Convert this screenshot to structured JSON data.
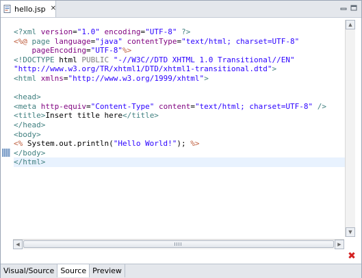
{
  "tab": {
    "label": "hello.jsp",
    "icon": "jsp-file-icon",
    "close_glyph": "✕"
  },
  "window_buttons": [
    "minimize-icon",
    "maximize-icon"
  ],
  "code_lines": [
    [
      {
        "c": "t-tag",
        "t": "<?xml "
      },
      {
        "c": "t-attr",
        "t": "version"
      },
      {
        "c": "t-plain",
        "t": "="
      },
      {
        "c": "t-str",
        "t": "\"1.0\""
      },
      {
        "c": "t-plain",
        "t": " "
      },
      {
        "c": "t-attr",
        "t": "encoding"
      },
      {
        "c": "t-plain",
        "t": "="
      },
      {
        "c": "t-str",
        "t": "\"UTF-8\""
      },
      {
        "c": "t-tag",
        "t": " ?>"
      }
    ],
    [
      {
        "c": "t-jsp",
        "t": "<%@ "
      },
      {
        "c": "t-tag",
        "t": "page "
      },
      {
        "c": "t-attr",
        "t": "language"
      },
      {
        "c": "t-plain",
        "t": "="
      },
      {
        "c": "t-str",
        "t": "\"java\""
      },
      {
        "c": "t-plain",
        "t": " "
      },
      {
        "c": "t-attr",
        "t": "contentType"
      },
      {
        "c": "t-plain",
        "t": "="
      },
      {
        "c": "t-str",
        "t": "\"text/html; charset=UTF-8\""
      }
    ],
    [
      {
        "c": "t-plain",
        "t": "    "
      },
      {
        "c": "t-attr",
        "t": "pageEncoding"
      },
      {
        "c": "t-plain",
        "t": "="
      },
      {
        "c": "t-str",
        "t": "\"UTF-8\""
      },
      {
        "c": "t-jsp",
        "t": "%>"
      }
    ],
    [
      {
        "c": "t-tag",
        "t": "<!DOCTYPE "
      },
      {
        "c": "t-plain",
        "t": "html "
      },
      {
        "c": "t-doc",
        "t": "PUBLIC "
      },
      {
        "c": "t-str",
        "t": "\"-//W3C//DTD XHTML 1.0 Transitional//EN\""
      }
    ],
    [
      {
        "c": "t-str",
        "t": "\"http://www.w3.org/TR/xhtml1/DTD/xhtml1-transitional.dtd\""
      },
      {
        "c": "t-tag",
        "t": ">"
      }
    ],
    [
      {
        "c": "t-tag",
        "t": "<html "
      },
      {
        "c": "t-attr",
        "t": "xmlns"
      },
      {
        "c": "t-plain",
        "t": "="
      },
      {
        "c": "t-str",
        "t": "\"http://www.w3.org/1999/xhtml\""
      },
      {
        "c": "t-tag",
        "t": ">"
      }
    ],
    [],
    [
      {
        "c": "t-tag",
        "t": "<head>"
      }
    ],
    [
      {
        "c": "t-tag",
        "t": "<meta "
      },
      {
        "c": "t-attr",
        "t": "http-equiv"
      },
      {
        "c": "t-plain",
        "t": "="
      },
      {
        "c": "t-str",
        "t": "\"Content-Type\""
      },
      {
        "c": "t-plain",
        "t": " "
      },
      {
        "c": "t-attr",
        "t": "content"
      },
      {
        "c": "t-plain",
        "t": "="
      },
      {
        "c": "t-str",
        "t": "\"text/html; charset=UTF-8\""
      },
      {
        "c": "t-tag",
        "t": " />"
      }
    ],
    [
      {
        "c": "t-tag",
        "t": "<title>"
      },
      {
        "c": "t-plain",
        "t": "Insert title here"
      },
      {
        "c": "t-tag",
        "t": "</title>"
      }
    ],
    [
      {
        "c": "t-tag",
        "t": "</head>"
      }
    ],
    [
      {
        "c": "t-tag",
        "t": "<body>"
      }
    ],
    [
      {
        "c": "t-jsp",
        "t": "<%"
      },
      {
        "c": "t-plain",
        "t": " System.out.println("
      },
      {
        "c": "t-str",
        "t": "\"Hello World!\""
      },
      {
        "c": "t-plain",
        "t": "); "
      },
      {
        "c": "t-jsp",
        "t": "%>"
      }
    ],
    [
      {
        "c": "t-tag",
        "t": "</body>"
      }
    ],
    [
      {
        "c": "t-tag",
        "t": "</html>"
      }
    ]
  ],
  "current_line_index": 14,
  "scrollbar_glyphs": {
    "up": "▲",
    "down": "▼",
    "left": "◀",
    "right": "▶"
  },
  "error_glyph": "✖",
  "bottom_tabs": [
    {
      "label": "Visual/Source",
      "active": false
    },
    {
      "label": "Source",
      "active": true
    },
    {
      "label": "Preview",
      "active": false
    }
  ]
}
